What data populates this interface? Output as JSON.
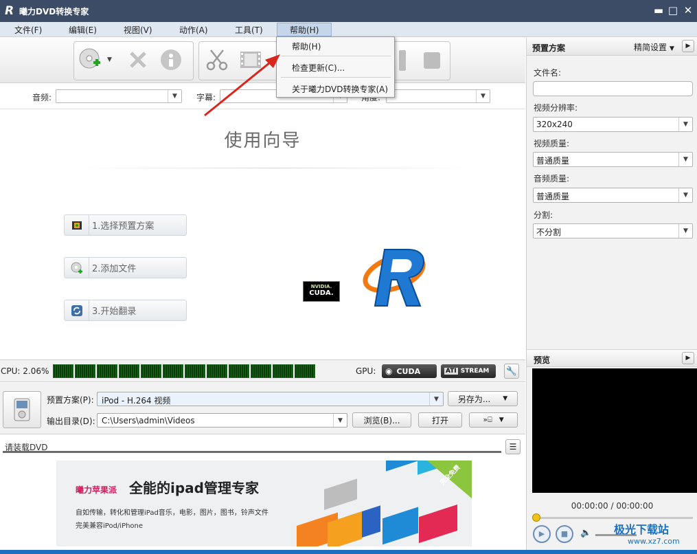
{
  "window": {
    "title": "曦力DVD转换专家",
    "logo_letter": "R",
    "minimize": "▬",
    "maximize": "□",
    "close": "✕"
  },
  "menu": [
    {
      "label": "文件(F)"
    },
    {
      "label": "编辑(E)"
    },
    {
      "label": "视图(V)"
    },
    {
      "label": "动作(A)"
    },
    {
      "label": "工具(T)"
    },
    {
      "label": "帮助(H)"
    }
  ],
  "help_menu": {
    "items": [
      "帮助(H)",
      "检查更新(C)...",
      "关于曦力DVD转换专家(A)"
    ]
  },
  "toolbar": {
    "icons": [
      "add-dvd-icon",
      "delete-icon",
      "info-icon",
      "scissors-icon",
      "film-icon",
      "pause-icon",
      "stop-icon"
    ]
  },
  "streams": {
    "audio_label": "音频:",
    "subtitle_label": "字幕:",
    "angle_label": "角度:"
  },
  "guide": {
    "title": "使用向导",
    "steps": [
      "1.选择预置方案",
      "2.添加文件",
      "3.开始翻录"
    ],
    "nvidia": {
      "brand": "NVIDIA.",
      "name": "CUDA."
    }
  },
  "cpu": {
    "label": "CPU: 2.06%",
    "gpu_label": "GPU:",
    "cuda": "CUDA",
    "ati": "ATI",
    "stream": "STREAM"
  },
  "preset": {
    "preset_label": "预置方案(P):",
    "preset_value": "iPod - H.264 视频",
    "save_as": "另存为...",
    "output_label": "输出目录(D):",
    "output_value": "C:\\Users\\admin\\Videos",
    "browse": "浏览(B)...",
    "open": "打开"
  },
  "status": {
    "text": "请装载DVD"
  },
  "ad": {
    "brand": "曦力苹果派",
    "headline": "全能的ipad管理专家",
    "line1": "自如传输，转化和管理iPad音乐，电影，图片，图书，铃声文件",
    "line2": "完美兼容iPod/iPhone",
    "ribbon": "完全免费"
  },
  "right_panel": {
    "preset_head": "预置方案",
    "mode": "精简设置",
    "filename_label": "文件名:",
    "filename_value": "",
    "resolution_label": "视频分辨率:",
    "resolution_value": "320x240",
    "video_quality_label": "视频质量:",
    "video_quality_value": "普通质量",
    "audio_quality_label": "音频质量:",
    "audio_quality_value": "普通质量",
    "split_label": "分割:",
    "split_value": "不分割",
    "preview_head": "预览",
    "time": "00:00:00 / 00:00:00"
  },
  "watermark": {
    "site": "极光下载站",
    "url": "www.xz7.com"
  },
  "colors": {
    "titlebar": "#3c4b66",
    "accent_blue": "#1a6fc0",
    "arrow_red": "#d9261c"
  }
}
